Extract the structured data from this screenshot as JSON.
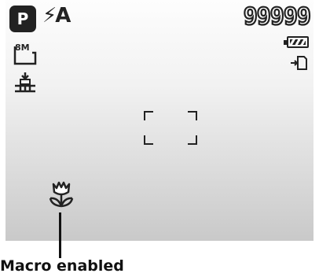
{
  "mode_badge": "P",
  "flash_mode": "⚡A",
  "remaining_shots": "99999",
  "caption": "Macro enabled",
  "icons": {
    "battery": "battery-icon",
    "storage": "memory-card-icon",
    "image_size": "image-size-8m-icon",
    "size_label": "8M",
    "quality": "quality-icon",
    "macro": "macro-flower-icon"
  }
}
